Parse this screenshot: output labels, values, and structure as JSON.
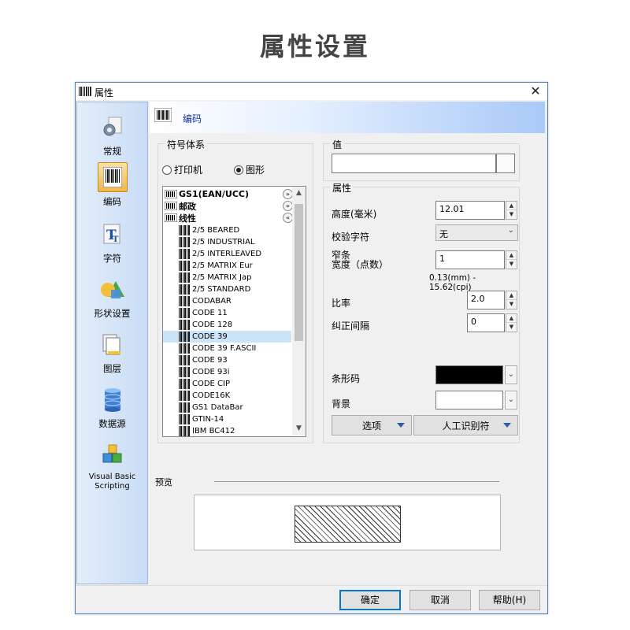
{
  "page_heading": "属性设置",
  "window": {
    "title": "属性",
    "close_glyph": "✕"
  },
  "sidebar": {
    "items": [
      {
        "label": "常规",
        "icon": "gear-icon"
      },
      {
        "label": "编码",
        "icon": "barcode-icon",
        "active": true
      },
      {
        "label": "字符",
        "icon": "font-icon"
      },
      {
        "label": "形状设置",
        "icon": "shapes-icon"
      },
      {
        "label": "图层",
        "icon": "layers-icon"
      },
      {
        "label": "数据源",
        "icon": "database-icon"
      },
      {
        "label": "Visual Basic Scripting",
        "icon": "vb-script-icon"
      }
    ]
  },
  "header": {
    "label": "编码"
  },
  "symbology": {
    "group_title": "符号体系",
    "radio_printer": "打印机",
    "radio_graphic": "图形",
    "selected_radio": "graphic",
    "categories": [
      {
        "label": "GS1(EAN/UCC)",
        "chevron": "»"
      },
      {
        "label": "邮政",
        "chevron": "»"
      },
      {
        "label": "线性",
        "chevron": "«"
      }
    ],
    "items": [
      "2/5 BEARED",
      "2/5 INDUSTRIAL",
      "2/5 INTERLEAVED",
      "2/5 MATRIX Eur",
      "2/5 MATRIX Jap",
      "2/5 STANDARD",
      "CODABAR",
      "CODE 11",
      "CODE 128",
      "CODE 39",
      "CODE 39 F.ASCII",
      "CODE 93",
      "CODE 93i",
      "CODE CIP",
      "CODE16K",
      "GS1 DataBar",
      "GTIN-14",
      "IBM BC412"
    ],
    "selected_item": "CODE 39"
  },
  "value_group": {
    "title": "值",
    "value": ""
  },
  "props": {
    "title": "属性",
    "height_label": "高度(毫米)",
    "height_value": "12.01",
    "check_label": "校验字符",
    "check_value": "无",
    "narrow_label_1": "窄条",
    "narrow_label_2": "宽度（点数）",
    "narrow_value": "1",
    "range_text": "0.13(mm) - 15.62(cpi)",
    "ratio_label": "比率",
    "ratio_value": "2.0",
    "correction_label": "纠正间隔",
    "correction_value": "0",
    "barcode_color_label": "条形码",
    "barcode_color": "#000000",
    "background_label": "背景",
    "background_color": "#ffffff",
    "options_button": "选项",
    "hri_button": "人工识别符"
  },
  "preview": {
    "label": "预览"
  },
  "footer": {
    "ok": "确定",
    "cancel": "取消",
    "help": "帮助(H)"
  }
}
